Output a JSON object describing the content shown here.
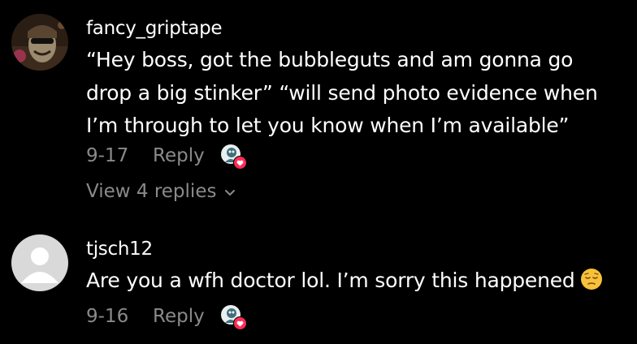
{
  "comments": [
    {
      "username": "fancy_griptape",
      "text_lines": [
        "“Hey boss, got the bubbleguts and am gonna go",
        "drop a big stinker” “will send photo evidence when",
        "I’m through to let you know when I’m available”"
      ],
      "date": "9-17",
      "reply_label": "Reply",
      "creator_liked_icon": "creator-liked-heart-icon",
      "view_replies_label": "View 4 replies"
    },
    {
      "username": "tjsch12",
      "text_lines": [
        "Are you a wfh doctor lol. I’m sorry this happened"
      ],
      "emoji": "pensive-face-icon",
      "date": "9-16",
      "reply_label": "Reply",
      "creator_liked_icon": "creator-liked-heart-icon"
    }
  ],
  "colors": {
    "background": "#000000",
    "primary_text": "#ffffff",
    "secondary_text": "#8a8a8a",
    "heart": "#fe2c55",
    "default_avatar_bg": "#d9d9d9"
  }
}
